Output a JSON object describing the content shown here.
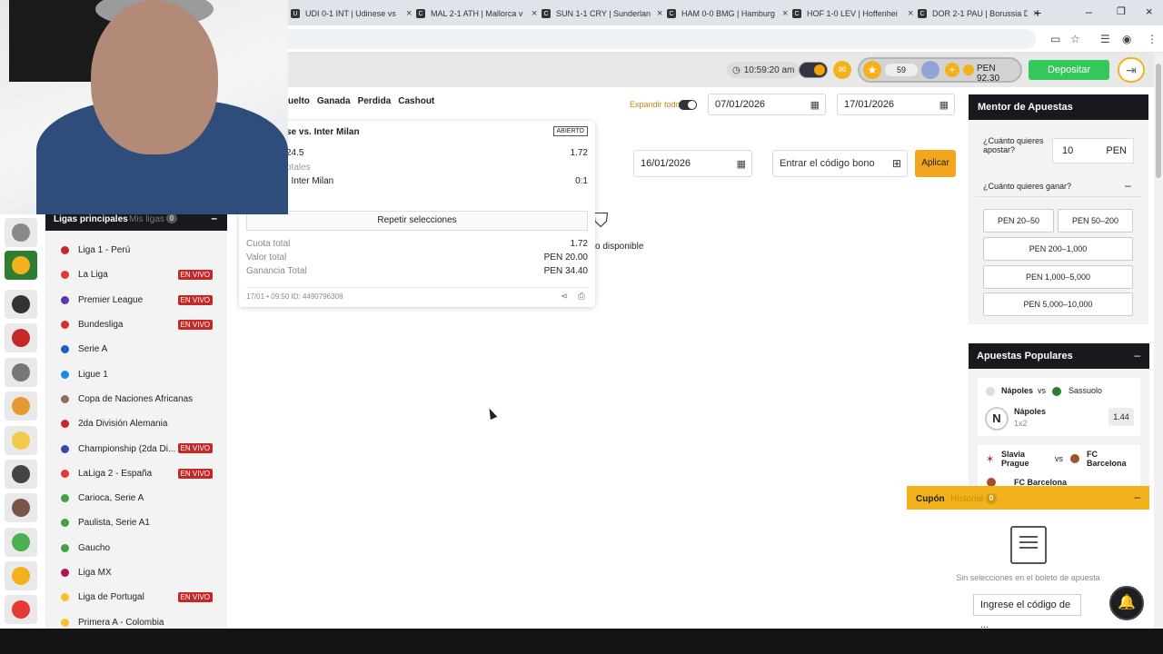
{
  "browser_tabs": [
    {
      "label": "UDI 0-1 INT | Udinese vs",
      "fav": "U"
    },
    {
      "label": "MAL 2-1 ATH | Mallorca v",
      "fav": "C"
    },
    {
      "label": "SUN 1-1 CRY | Sunderlan",
      "fav": "C"
    },
    {
      "label": "HAM 0-0 BMG | Hamburg",
      "fav": "C"
    },
    {
      "label": "HOF 1-0 LEV | Hoffenhei",
      "fav": "C"
    },
    {
      "label": "DOR 2-1 PAU | Borussia D",
      "fav": "C"
    }
  ],
  "header": {
    "clock": "10:59:20 am",
    "level": "59",
    "balance": "PEN 92.30",
    "deposit": "Depositar"
  },
  "filters": [
    "uelto",
    "Ganada",
    "Perdida",
    "Cashout"
  ],
  "expand_all": "Expandir todo",
  "dates": {
    "from": "07/01/2026",
    "to": "17/01/2026",
    "single": "16/01/2026"
  },
  "bonus": {
    "placeholder": "Entrar el código bono",
    "apply": "Aplicar"
  },
  "not_available": "o disponible",
  "bet": {
    "match": "se vs. Inter Milan",
    "status": "ABIERTO",
    "line1": "24.5",
    "line1_odds": "1.72",
    "line2": "otales",
    "line3": ". Inter Milan",
    "score": "0:1",
    "repeat": "Repetir selecciones",
    "total_odds_label": "Cuota total",
    "total_odds": "1.72",
    "total_value_label": "Valor total",
    "total_value": "PEN 20.00",
    "total_win_label": "Ganancia Total",
    "total_win": "PEN 34.40",
    "footer": "17/01 • 09:50   ID: 4490796308"
  },
  "leagues_panel": {
    "tab_main": "Ligas principales",
    "tab_mine": "Mis ligas",
    "mine_count": "0",
    "live_label": "EN VIVO",
    "items": [
      {
        "name": "Liga 1 - Perú",
        "live": false,
        "color": "#c62828"
      },
      {
        "name": "La Liga",
        "live": true,
        "color": "#e53935"
      },
      {
        "name": "Premier League",
        "live": true,
        "color": "#5e35b1"
      },
      {
        "name": "Bundesliga",
        "live": true,
        "color": "#d32f2f"
      },
      {
        "name": "Serie A",
        "live": false,
        "color": "#1565c0"
      },
      {
        "name": "Ligue 1",
        "live": false,
        "color": "#1e88e5"
      },
      {
        "name": "Copa de Naciones Africanas",
        "live": false,
        "color": "#8d6e63"
      },
      {
        "name": "2da División Alemania",
        "live": false,
        "color": "#c62828"
      },
      {
        "name": "Championship (2da Di...",
        "live": true,
        "color": "#3949ab"
      },
      {
        "name": "LaLiga 2 - España",
        "live": true,
        "color": "#e53935"
      },
      {
        "name": "Carioca, Serie A",
        "live": false,
        "color": "#43a047"
      },
      {
        "name": "Paulista, Serie A1",
        "live": false,
        "color": "#43a047"
      },
      {
        "name": "Gaucho",
        "live": false,
        "color": "#43a047"
      },
      {
        "name": "Liga MX",
        "live": false,
        "color": "#ad1457"
      },
      {
        "name": "Liga de Portugal",
        "live": true,
        "color": "#fbc02d"
      },
      {
        "name": "Primera A - Colombia",
        "live": false,
        "color": "#fbc02d"
      }
    ]
  },
  "mentor": {
    "title": "Mentor de Apuestas",
    "stake_q": "¿Cuánto quieres apostar?",
    "stake_value": "10",
    "currency": "PEN",
    "win_q": "¿Cuánto quieres ganar?",
    "ranges": [
      "PEN 20–50",
      "PEN 50–200",
      "PEN 200–1,000",
      "PEN 1,000–5,000",
      "PEN 5,000–10,000"
    ]
  },
  "popular": {
    "title": "Apuestas Populares",
    "m1_home": "Nápoles",
    "vs": "vs",
    "m1_away": "Sassuolo",
    "m1_pick": "Nápoles",
    "m1_market": "1x2",
    "m1_odds": "1.44",
    "m2_home": "Slavia Prague",
    "m2_away": "FC Barcelona",
    "m2_pick": "FC Barcelona"
  },
  "coupon": {
    "tab_coupon": "Cupón",
    "tab_history": "Historial",
    "count": "0",
    "empty": "Sin selecciones en el boleto de apuesta",
    "code_placeholder": "Ingrese el código de ..."
  }
}
